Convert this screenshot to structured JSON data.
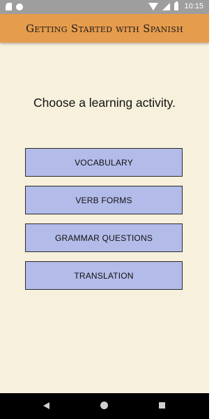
{
  "status_bar": {
    "time": "10:15",
    "left_icons": [
      "sd-card-icon",
      "circle-notification-icon"
    ],
    "right_icons": [
      "wifi-icon",
      "signal-icon",
      "battery-icon"
    ]
  },
  "app_bar": {
    "title": "Getting Started with Spanish",
    "color": "#e69c4d"
  },
  "main": {
    "heading": "Choose a learning activity.",
    "background": "#f7f0dc",
    "activities": [
      {
        "label": "VOCABULARY"
      },
      {
        "label": "VERB FORMS"
      },
      {
        "label": "GRAMMAR QUESTIONS"
      },
      {
        "label": "TRANSLATION"
      }
    ],
    "button_color": "#b3bbe9"
  },
  "nav_bar": {
    "icons": [
      "back-icon",
      "home-icon",
      "recents-icon"
    ]
  }
}
